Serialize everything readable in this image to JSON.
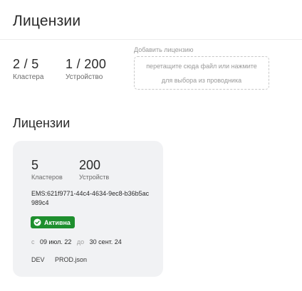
{
  "header": {
    "title": "Лицензии"
  },
  "summary": {
    "clusters": {
      "value": "2 / 5",
      "label": "Кластера"
    },
    "devices": {
      "value": "1 / 200",
      "label": "Устройство"
    }
  },
  "upload": {
    "label": "Добавить лицензию",
    "hint_line1": "перетащите сюда файл или нажмите",
    "hint_line2": "для выбора из проводника"
  },
  "licenses_section": {
    "title": "Лицензии"
  },
  "license_card": {
    "clusters": {
      "value": "5",
      "label": "Кластеров"
    },
    "devices": {
      "value": "200",
      "label": "Устройств"
    },
    "id": "EMS:621f9771-44c4-4634-9ec8-b36b5ac989c4",
    "status": {
      "label": "Активна",
      "color": "#1e8f2e"
    },
    "dates": {
      "from_label": "с",
      "from": "09 июл. 22",
      "to_label": "до",
      "to": "30 сент. 24"
    },
    "files": [
      "DEV",
      "PROD.json"
    ]
  }
}
